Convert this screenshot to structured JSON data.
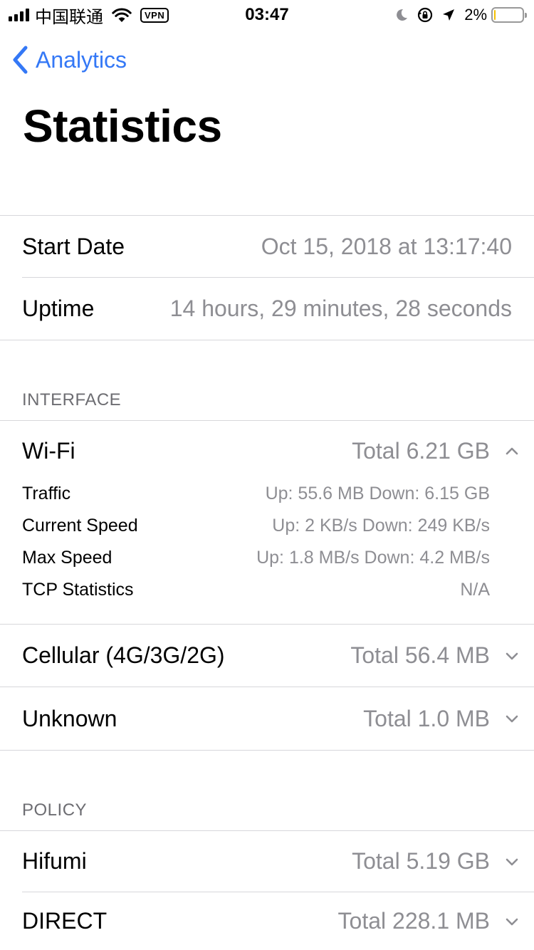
{
  "status_bar": {
    "carrier": "中国联通",
    "vpn": "VPN",
    "time": "03:47",
    "battery_percent": "2%"
  },
  "nav": {
    "back_label": "Analytics",
    "title": "Statistics"
  },
  "info": {
    "start_date_label": "Start Date",
    "start_date_value": "Oct 15, 2018 at 13:17:40",
    "uptime_label": "Uptime",
    "uptime_value": "14 hours, 29 minutes, 28 seconds"
  },
  "interface": {
    "header": "INTERFACE",
    "wifi": {
      "label": "Wi-Fi",
      "total": "Total 6.21 GB",
      "details": [
        {
          "label": "Traffic",
          "value": "Up: 55.6 MB Down: 6.15 GB"
        },
        {
          "label": "Current Speed",
          "value": "Up: 2 KB/s Down: 249 KB/s"
        },
        {
          "label": "Max Speed",
          "value": "Up: 1.8 MB/s Down: 4.2 MB/s"
        },
        {
          "label": "TCP Statistics",
          "value": "N/A"
        }
      ]
    },
    "cellular": {
      "label": "Cellular (4G/3G/2G)",
      "total": "Total 56.4 MB"
    },
    "unknown": {
      "label": "Unknown",
      "total": "Total 1.0 MB"
    }
  },
  "policy": {
    "header": "POLICY",
    "items": [
      {
        "label": "Hifumi",
        "total": "Total 5.19 GB"
      },
      {
        "label": "DIRECT",
        "total": "Total 228.1 MB"
      }
    ]
  },
  "colors": {
    "accent": "#3478f6",
    "secondary_text": "#8e8e93",
    "separator": "#d7d7db",
    "battery_low": "#f5c000"
  },
  "icons": [
    "cellular-signal-icon",
    "wifi-icon",
    "moon-icon",
    "rotation-lock-icon",
    "location-arrow-icon",
    "battery-icon",
    "back-chevron-icon",
    "chevron-up-icon",
    "chevron-down-icon"
  ]
}
